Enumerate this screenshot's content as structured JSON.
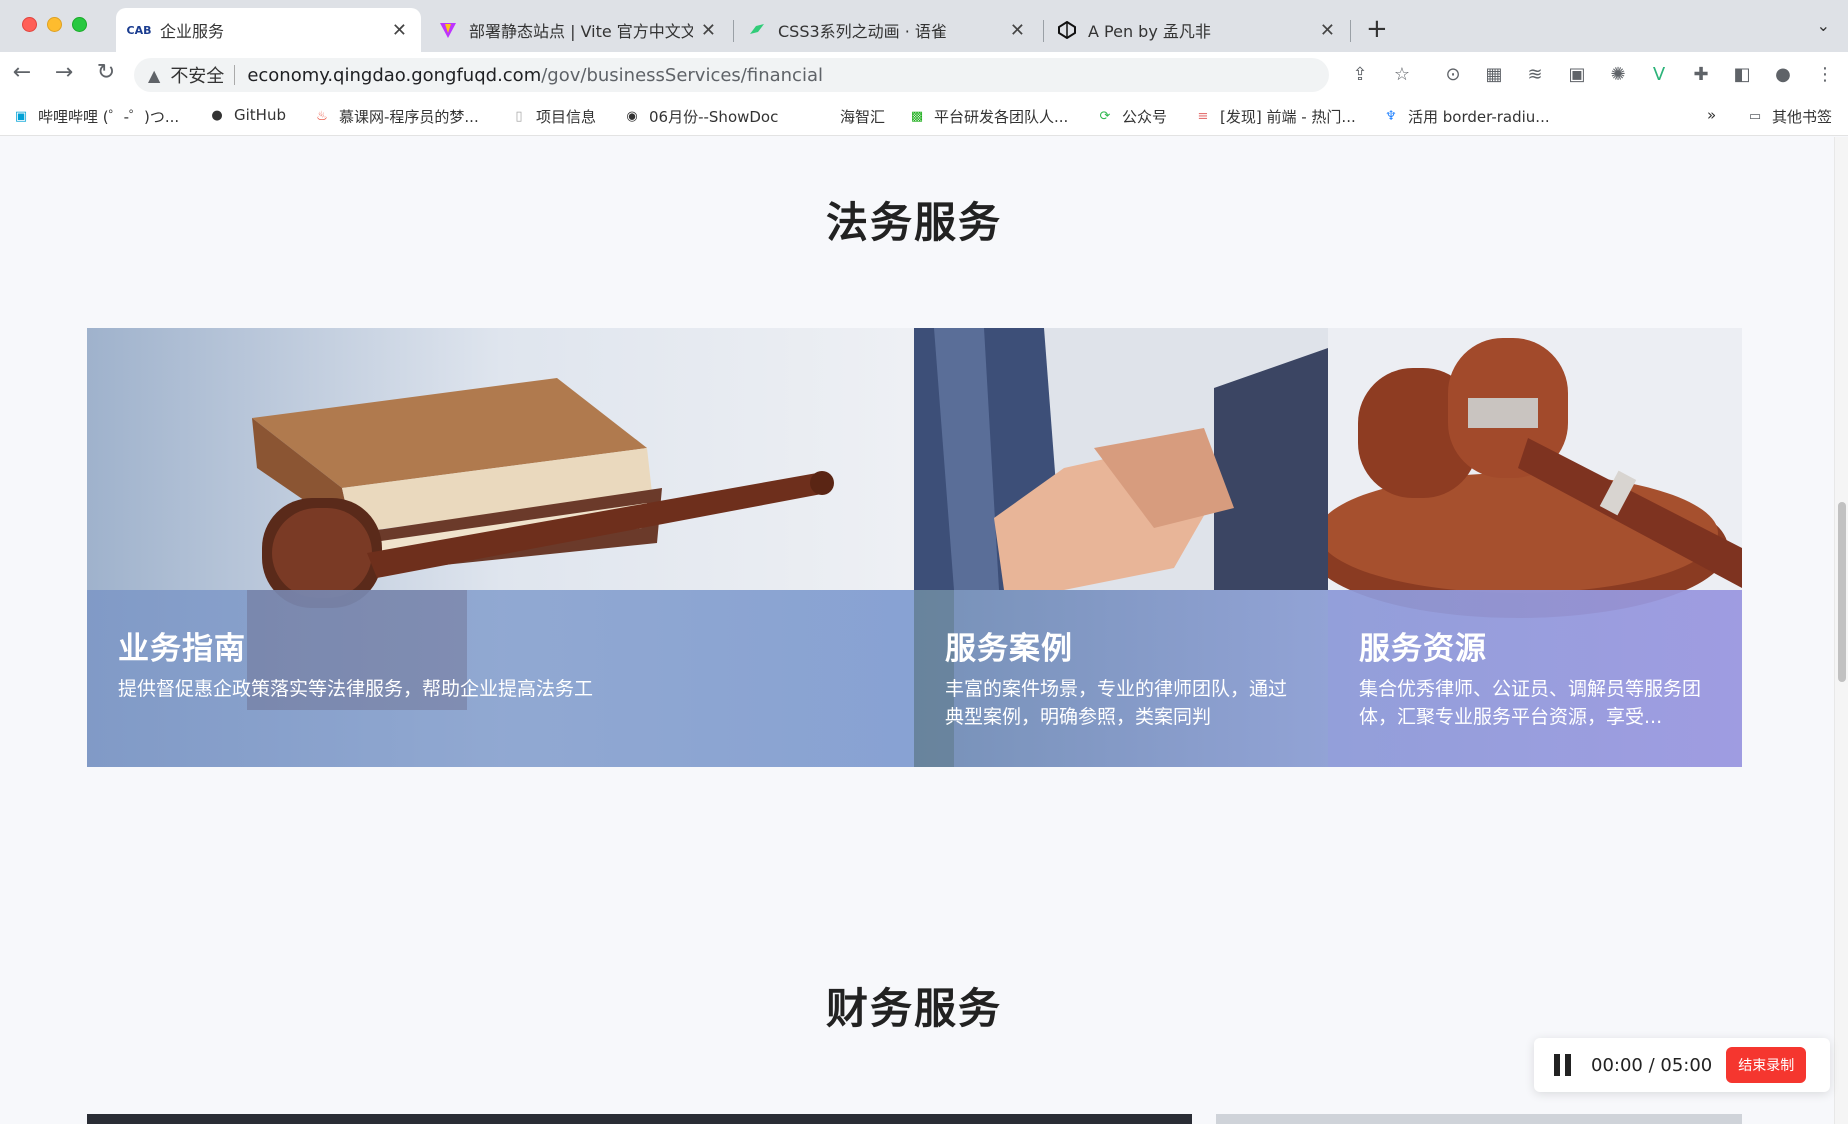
{
  "browser": {
    "tabs": [
      {
        "label": "企业服务",
        "favicon": "CAB",
        "active": true
      },
      {
        "label": "部署静态站点 | Vite 官方中文文档",
        "favicon": "vite-icon",
        "active": false
      },
      {
        "label": "CSS3系列之动画 · 语雀",
        "favicon": "yuque-icon",
        "active": false
      },
      {
        "label": "A Pen by 孟凡非",
        "favicon": "codepen-icon",
        "active": false
      }
    ],
    "insecure_label": "不安全",
    "url_host": "economy.qingdao.gongfuqd.com",
    "url_path": "/gov/businessServices/financial",
    "bookmarks": [
      {
        "label": "哔哩哔哩 (゜-゜)つ...",
        "icon": "bilibili-icon"
      },
      {
        "label": "GitHub",
        "icon": "github-icon"
      },
      {
        "label": "慕课网-程序员的梦...",
        "icon": "flame-icon"
      },
      {
        "label": "项目信息",
        "icon": "page-icon"
      },
      {
        "label": "06月份--ShowDoc",
        "icon": "showdoc-icon"
      },
      {
        "label": "海智汇",
        "icon": ""
      },
      {
        "label": "平台研发各团队人...",
        "icon": "sheet-icon"
      },
      {
        "label": "公众号",
        "icon": "refresh-green-icon"
      },
      {
        "label": "[发现] 前端 - 热门...",
        "icon": "list-icon"
      },
      {
        "label": "活用 border-radiu...",
        "icon": "juejin-icon"
      }
    ],
    "bookmarks_more": "»",
    "other_bookmarks": "其他书签"
  },
  "page": {
    "legal_title": "法务服务",
    "cards": [
      {
        "title": "业务指南",
        "desc": "提供督促惠企政策落实等法律服务，帮助企业提高法务工"
      },
      {
        "title": "服务案例",
        "desc": "丰富的案件场景，专业的律师团队，通过典型案例，明确参照，类案同判"
      },
      {
        "title": "服务资源",
        "desc": "集合优秀律师、公证员、调解员等服务团体，汇聚专业服务平台资源，享受..."
      }
    ],
    "finance_title": "财务服务"
  },
  "recorder": {
    "time": "00:00 / 05:00",
    "stop_label": "结束录制"
  },
  "colors": {
    "accent_red": "#f5362f",
    "overlay_blue": "#7f98c8",
    "overlay_purple": "#9a9ce0"
  }
}
